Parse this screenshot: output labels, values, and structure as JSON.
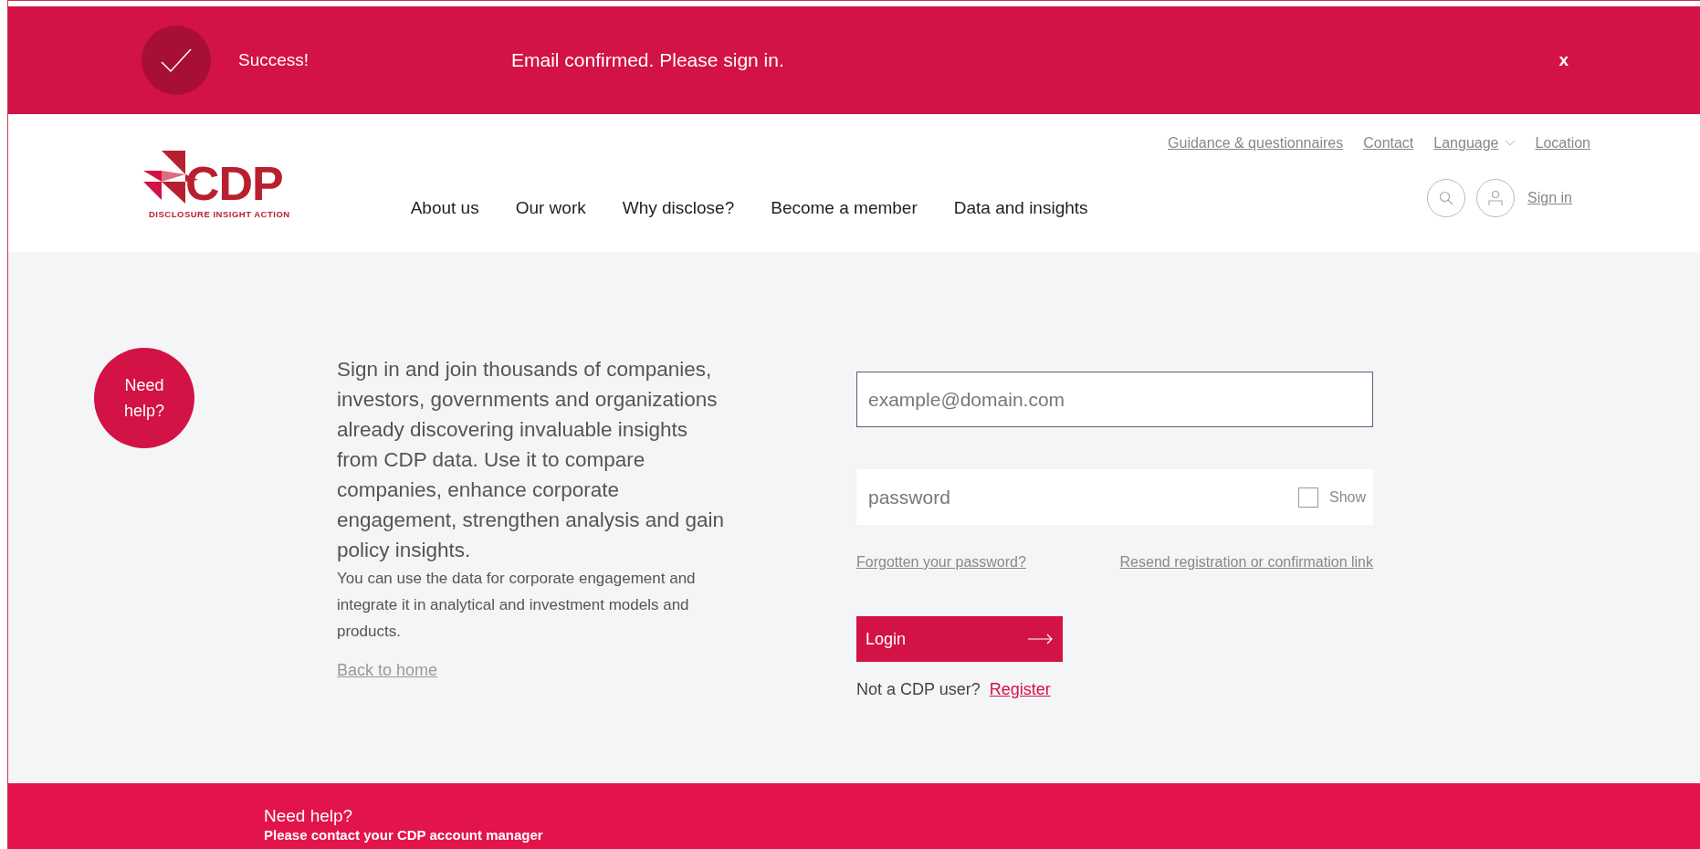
{
  "alert": {
    "title": "Success!",
    "message": "Email confirmed. Please sign in.",
    "close": "x"
  },
  "logo": {
    "text": "CDP",
    "tagline": "DISCLOSURE INSIGHT ACTION"
  },
  "utility_links": [
    {
      "label": "Guidance & questionnaires",
      "kind": "link"
    },
    {
      "label": "Contact",
      "kind": "link"
    },
    {
      "label": "Language",
      "kind": "dropdown"
    },
    {
      "label": "Location",
      "kind": "link"
    }
  ],
  "nav": [
    "About us",
    "Our work",
    "Why disclose?",
    "Become a member",
    "Data and insights"
  ],
  "account": {
    "sign_in": "Sign in"
  },
  "help_badge": "Need help?",
  "intro": {
    "lead": "Sign in and join thousands of companies, investors, governments and organizations already discovering invaluable insights from CDP data. Use it to compare companies, enhance corporate engagement, strengthen analysis and gain policy insights.",
    "detail": "You can use the data for corporate engagement and integrate it in analytical and investment models and products.",
    "back_link": "Back to home"
  },
  "form": {
    "email": {
      "placeholder": "example@domain.com",
      "focused": true
    },
    "password": {
      "placeholder": "password",
      "focused": false
    },
    "show": {
      "label": "Show",
      "checked": false
    },
    "forgot_link": "Forgotten your password?",
    "resend_link": "Resend registration or confirmation link",
    "login": "Login",
    "register_prompt": "Not a CDP user?",
    "register_link": "Register"
  },
  "footer": {
    "title": "Need help?",
    "text": "Please contact your CDP account manager"
  }
}
